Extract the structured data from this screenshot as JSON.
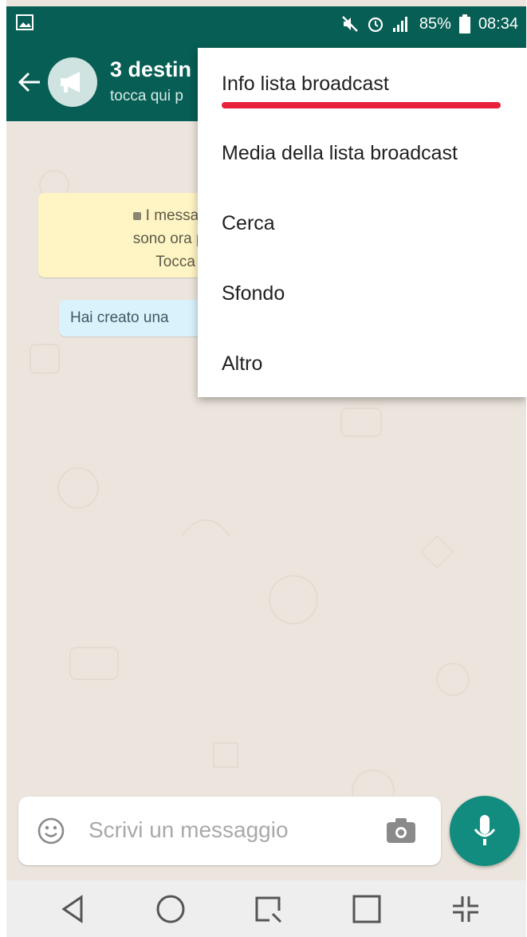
{
  "status_bar": {
    "battery": "85%",
    "time": "08:34"
  },
  "header": {
    "title": "3 destin",
    "subtitle": "tocca qui p"
  },
  "chat": {
    "system_notice_lines": [
      "I messaggi c",
      "sono ora prote",
      "Tocca p"
    ],
    "info_bubble": "Hai creato una"
  },
  "menu": {
    "items": [
      {
        "label": "Info lista broadcast"
      },
      {
        "label": "Media della lista broadcast"
      },
      {
        "label": "Cerca"
      },
      {
        "label": "Sfondo"
      },
      {
        "label": "Altro"
      }
    ],
    "highlight_color": "#e8223a"
  },
  "input": {
    "placeholder": "Scrivi un messaggio"
  },
  "colors": {
    "header": "#075e54",
    "fab": "#128c7e",
    "system_bubble": "#fff5c4",
    "info_bubble": "#d9f2fb",
    "chat_bg": "#ece5dd"
  }
}
